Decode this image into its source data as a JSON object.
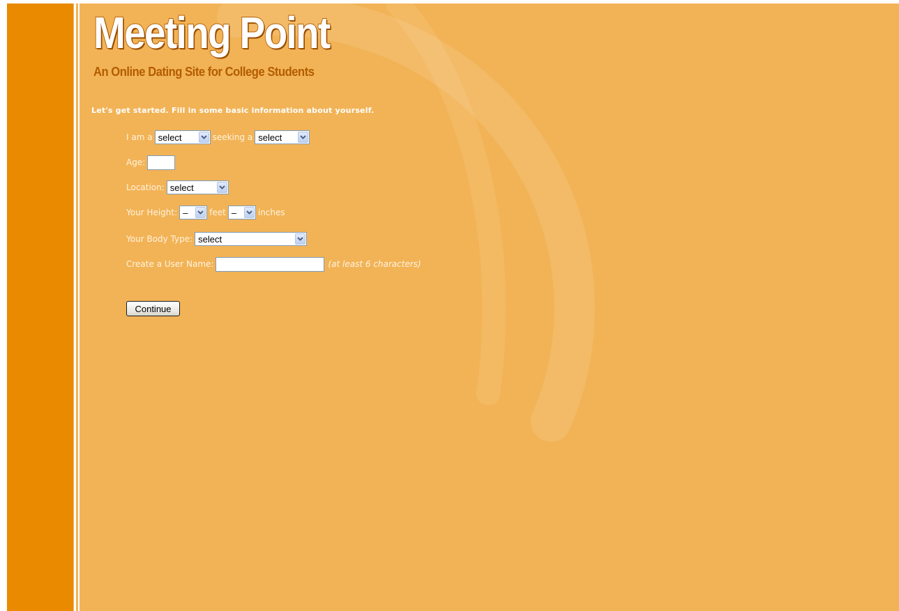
{
  "header": {
    "logo": "Meeting Point",
    "tagline": "An Online Dating Site for College Students"
  },
  "intro": "Let's get started. Fill in some basic information about yourself.",
  "form": {
    "gender": {
      "label": "I am a",
      "value": "select",
      "seeking_label": "seeking a",
      "seeking_value": "select"
    },
    "age": {
      "label": "Age:",
      "value": ""
    },
    "location": {
      "label": "Location:",
      "value": "select"
    },
    "height": {
      "label": "Your Height:",
      "feet_value": "–",
      "feet_unit": "feet",
      "inches_value": "–",
      "inches_unit": "inches"
    },
    "body_type": {
      "label": "Your Body Type:",
      "value": "select"
    },
    "username": {
      "label": "Create a User Name:",
      "value": "",
      "hint": "(at least 6 characters)"
    },
    "continue_label": "Continue"
  },
  "colors": {
    "background": "#f2b356",
    "left_bar": "#e98a00",
    "tagline": "#b35c00"
  }
}
